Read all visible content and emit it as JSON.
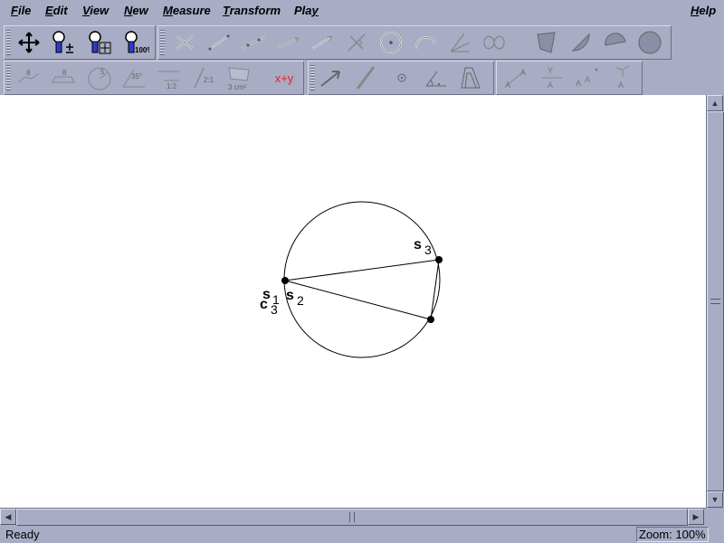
{
  "menubar": {
    "items": [
      {
        "label": "File",
        "accel": "F"
      },
      {
        "label": "Edit",
        "accel": "E"
      },
      {
        "label": "View",
        "accel": "V"
      },
      {
        "label": "New",
        "accel": "N"
      },
      {
        "label": "Measure",
        "accel": "M"
      },
      {
        "label": "Transform",
        "accel": "T"
      },
      {
        "label": "Play",
        "accel": "y"
      }
    ],
    "help": "Help"
  },
  "toolbar1": {
    "tools": [
      {
        "icon": "move-icon"
      },
      {
        "icon": "zoom-in-out-icon"
      },
      {
        "icon": "zoom-fit-icon"
      },
      {
        "icon": "zoom-100-icon",
        "text": "100%"
      },
      {
        "icon": "intersection-point-icon"
      },
      {
        "icon": "segment-icon"
      },
      {
        "icon": "line-icon"
      },
      {
        "icon": "ray-icon"
      },
      {
        "icon": "vector-icon"
      },
      {
        "icon": "perpendicular-icon"
      },
      {
        "icon": "circle-center-point-icon"
      },
      {
        "icon": "arc-icon"
      },
      {
        "icon": "angle-bisector-icon"
      },
      {
        "icon": "locus-icon"
      },
      {
        "icon": "polygon-fill-icon"
      },
      {
        "icon": "sector-fill-icon"
      },
      {
        "icon": "segment-fill-icon"
      },
      {
        "icon": "circle-fill-icon"
      }
    ]
  },
  "toolbar2": {
    "tools": [
      {
        "icon": "measure-distance-icon"
      },
      {
        "icon": "measure-length-icon"
      },
      {
        "icon": "measure-radius-icon"
      },
      {
        "icon": "measure-angle-icon",
        "text": "35°"
      },
      {
        "icon": "measure-ratio-icon",
        "text": "1:2"
      },
      {
        "icon": "measure-slope-icon",
        "text": "2:1"
      },
      {
        "icon": "measure-area-icon",
        "text": "3 cm²"
      },
      {
        "icon": "calculate-icon",
        "text": "x+y"
      },
      {
        "icon": "translate-icon"
      },
      {
        "icon": "reflect-icon"
      },
      {
        "icon": "rotate-point-icon"
      },
      {
        "icon": "rotate-icon"
      },
      {
        "icon": "dilate-icon"
      },
      {
        "icon": "label-point-icon"
      },
      {
        "icon": "label-segment-icon"
      },
      {
        "icon": "label-angle-icon"
      },
      {
        "icon": "label-vertex-icon"
      }
    ]
  },
  "canvas": {
    "labels": {
      "s3": {
        "main": "s",
        "sub": "3"
      },
      "s2": {
        "main": "s",
        "sub": "2"
      },
      "s1": {
        "main": "s",
        "sub": "1"
      },
      "c3": {
        "main": "c",
        "sub": "3"
      }
    }
  },
  "statusbar": {
    "status": "Ready",
    "zoom": "Zoom: 100%"
  },
  "colors": {
    "chrome": "#a8acc4",
    "canvas": "#ffffff",
    "calc_text": "#e8202a"
  }
}
